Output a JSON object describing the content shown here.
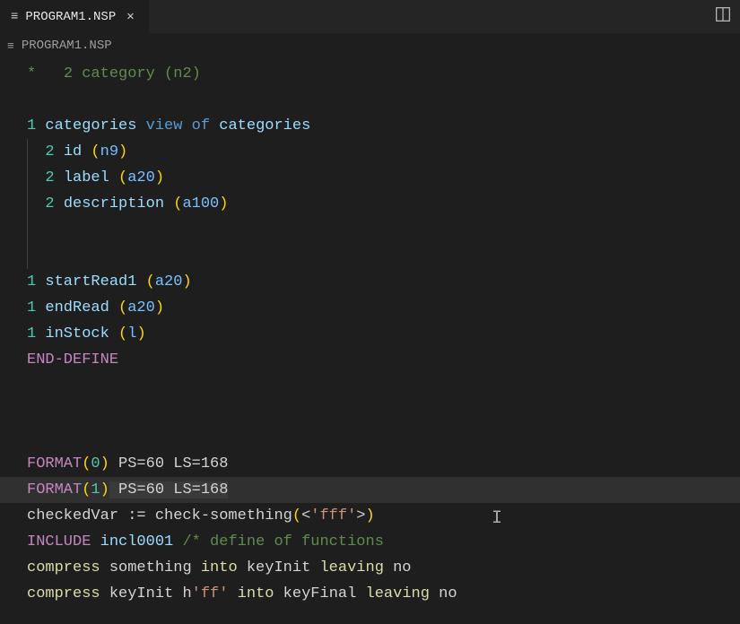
{
  "tab": {
    "filename": "PROGRAM1.NSP"
  },
  "breadcrumb": {
    "filename": "PROGRAM1.NSP"
  },
  "lines": {
    "l0_star": "*",
    "l0_level": "2",
    "l0_ident": "category",
    "l0_type": "(n2)",
    "l1_level": "1",
    "l1_ident": "categories",
    "l1_kw": "view of",
    "l1_ident2": "categories",
    "l2_level": "2",
    "l2_ident": "id",
    "l2_type": "(n9)",
    "l3_level": "2",
    "l3_ident": "label",
    "l3_type": "(a20)",
    "l4_level": "2",
    "l4_ident": "description",
    "l4_type": "(a100)",
    "l5_level": "1",
    "l5_ident": "startRead1",
    "l5_type": "(a20)",
    "l6_level": "1",
    "l6_ident": "endRead",
    "l6_type": "(a20)",
    "l7_level": "1",
    "l7_ident": "inStock",
    "l7_type": "(l)",
    "l8_define": "END-DEFINE",
    "f0_kw": "FORMAT",
    "f0_open": "(",
    "f0_num": "0",
    "f0_close": ")",
    "f0_rest": " PS=60 LS=168",
    "f1_kw": "FORMAT",
    "f1_open": "(",
    "f1_num": "1",
    "f1_close": ")",
    "f1_rest": " PS=60 LS=168",
    "cv_lhs": "checkedVar := check-something",
    "cv_open": "(",
    "cv_angle_open": "<",
    "cv_str": "'fff'",
    "cv_angle_close": ">",
    "cv_close": ")",
    "inc_kw": "INCLUDE",
    "inc_ident": " incl0001 ",
    "inc_comment": "/* define of functions",
    "cmp1_a": "compress",
    "cmp1_b": " something ",
    "cmp1_c": "into",
    "cmp1_d": " keyInit ",
    "cmp1_e": "leaving",
    "cmp1_f": " no",
    "cmp2_a": "compress",
    "cmp2_b": " keyInit h",
    "cmp2_str": "'ff'",
    "cmp2_c": " ",
    "cmp2_d": "into",
    "cmp2_e": " keyFinal ",
    "cmp2_f": "leaving",
    "cmp2_g": " no"
  }
}
